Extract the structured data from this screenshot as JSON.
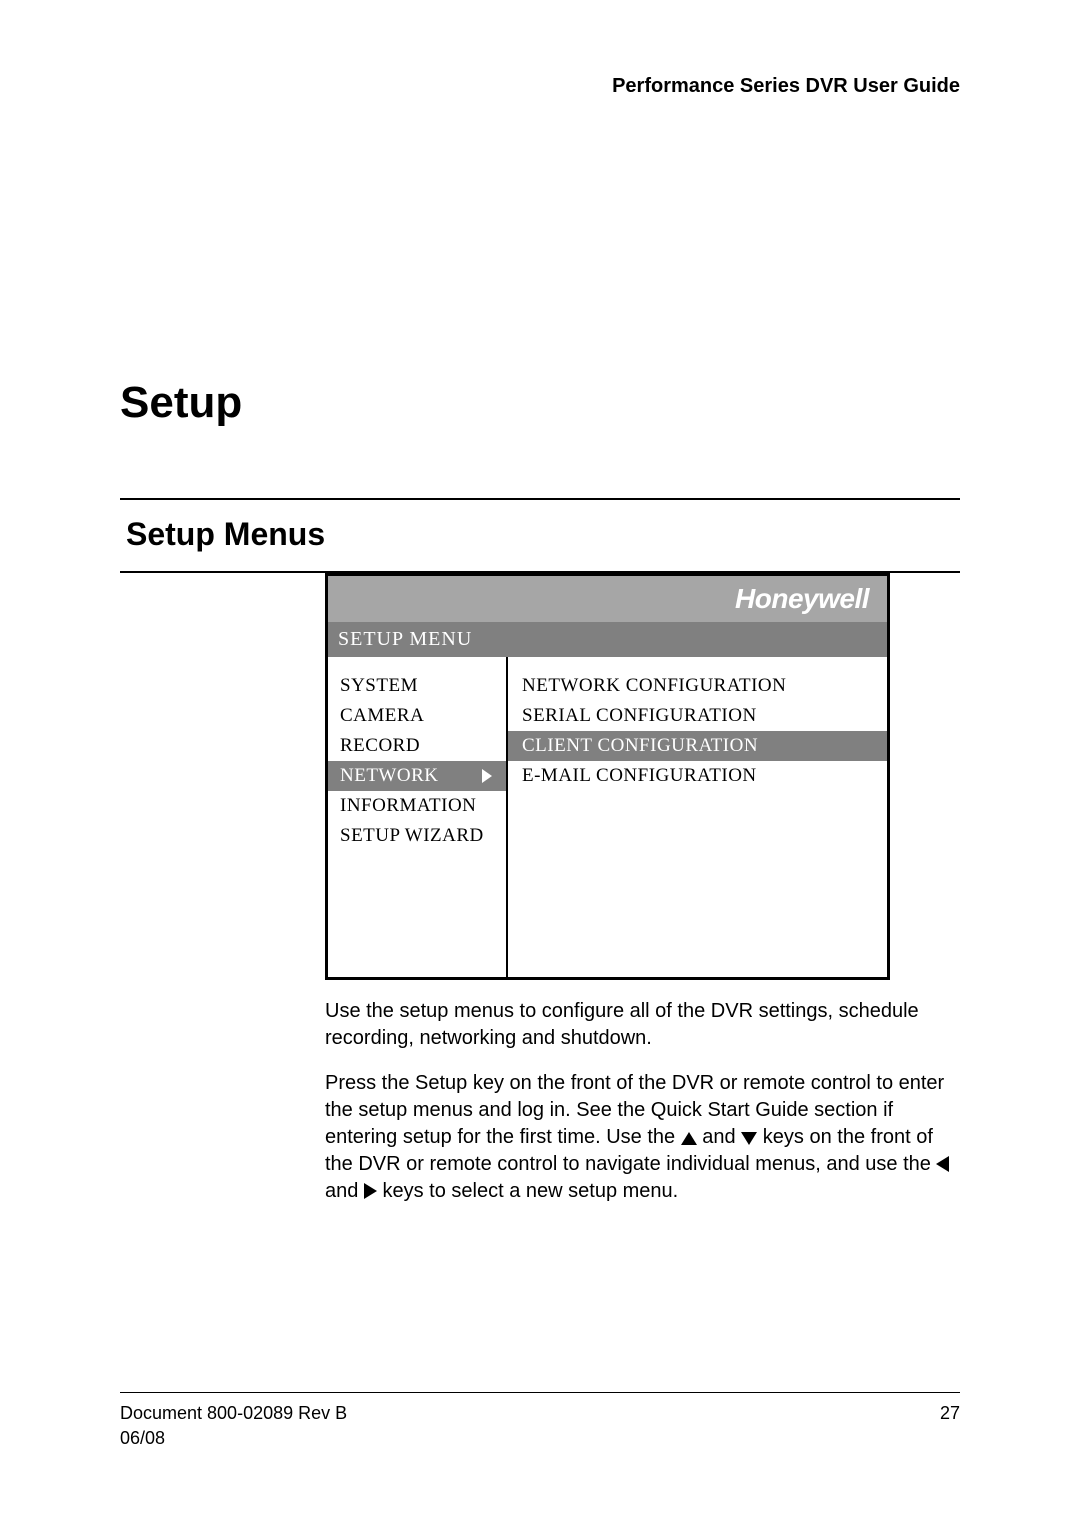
{
  "header": {
    "running": "Performance Series DVR User Guide"
  },
  "titles": {
    "page": "Setup",
    "section": "Setup Menus"
  },
  "menu": {
    "brand": "Honeywell",
    "title": "SETUP MENU",
    "left": {
      "items": [
        {
          "label": "SYSTEM",
          "selected": false
        },
        {
          "label": "CAMERA",
          "selected": false
        },
        {
          "label": "RECORD",
          "selected": false
        },
        {
          "label": "NETWORK",
          "selected": true
        },
        {
          "label": "INFORMATION",
          "selected": false
        },
        {
          "label": "SETUP WIZARD",
          "selected": false
        }
      ]
    },
    "right": {
      "items": [
        {
          "label": "NETWORK CONFIGURATION",
          "selected": false
        },
        {
          "label": "SERIAL CONFIGURATION",
          "selected": false
        },
        {
          "label": "CLIENT CONFIGURATION",
          "selected": true
        },
        {
          "label": "E-MAIL CONFIGURATION",
          "selected": false
        }
      ]
    }
  },
  "paragraphs": {
    "p1": "Use the setup menus to configure all of the DVR settings, schedule recording, networking and shutdown.",
    "p2a": "Press the Setup key on the front of the DVR or remote control to enter the setup menus and log in. See the Quick Start Guide section if entering setup for the first time. Use the ",
    "p2b": " and ",
    "p2c": " keys on the front of the DVR or remote control to navigate individual menus, and use the ",
    "p2d": " and ",
    "p2e": " keys to select a new setup menu."
  },
  "footer": {
    "doc": "Document 800-02089  Rev B",
    "page": "27",
    "date": "06/08"
  }
}
